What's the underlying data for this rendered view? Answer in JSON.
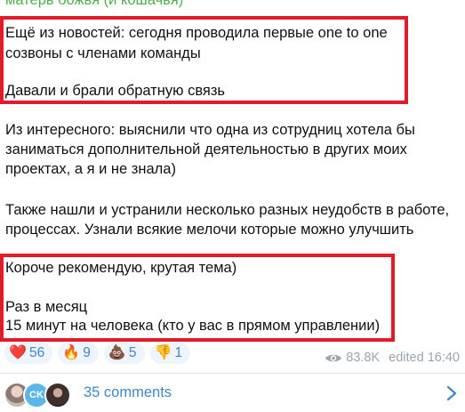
{
  "channel": {
    "name": "матерь божья (и кошачья)"
  },
  "message": {
    "lines": [
      "Ещё из новостей: сегодня проводила первые one to one",
      "созвоны с членами команды",
      "",
      "Давали и брали обратную связь",
      "",
      "Из интересного: выяснили что одна из сотрудниц хотела бы",
      "заниматься дополнительной деятельностью в других моих",
      "проектах, а я и не знала)",
      "",
      "Также нашли и устранили несколько разных неудобств в работе,",
      "процессах. Узнали всякие мелочи которые можно улучшить",
      "",
      "Короче рекомендую, крутая тема)",
      "",
      "Раз в месяц",
      "15 минут на человека (кто у вас в прямом управлении)"
    ]
  },
  "reactions": [
    {
      "emoji": "❤️",
      "count": "56",
      "icon": "heart-icon"
    },
    {
      "emoji": "🔥",
      "count": "9",
      "icon": "fire-icon"
    },
    {
      "emoji": "💩",
      "count": "5",
      "icon": "poop-icon"
    },
    {
      "emoji": "👎",
      "count": "1",
      "icon": "thumbs-down-icon"
    }
  ],
  "meta": {
    "views": "83.8K",
    "edited": "edited 16:40"
  },
  "comments": {
    "label": "35 comments",
    "avatar_initials": "CK"
  },
  "colors": {
    "accent": "#3e88c7",
    "channel_name": "#4fae4e",
    "highlight_border": "#e11b2a"
  }
}
